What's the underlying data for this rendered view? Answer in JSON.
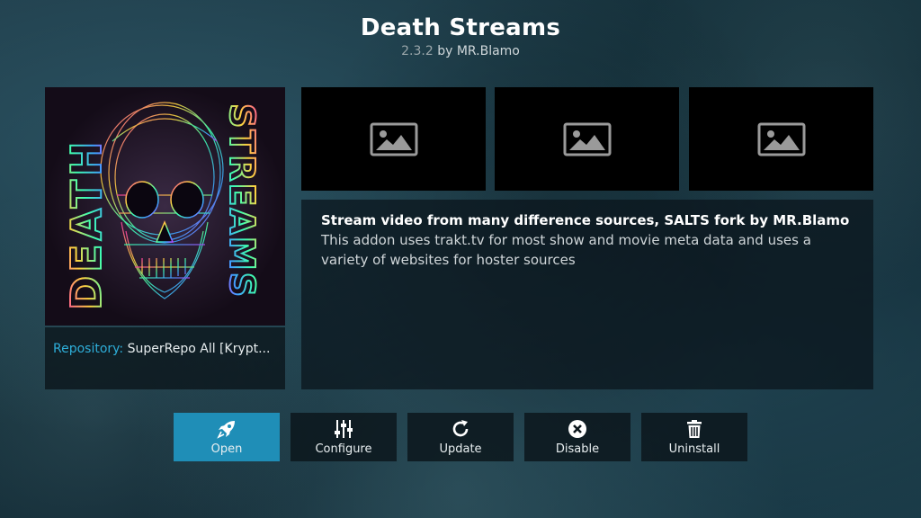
{
  "addon": {
    "title": "Death Streams",
    "version": "2.3.2",
    "author_text": "by MR.Blamo"
  },
  "repository": {
    "label": "Repository:",
    "value": "SuperRepo All [Krypt..."
  },
  "poster": {
    "left_word": "DEATH",
    "right_word": "STREAMS"
  },
  "screenshots": [
    {
      "icon": "image-placeholder-icon"
    },
    {
      "icon": "image-placeholder-icon"
    },
    {
      "icon": "image-placeholder-icon"
    }
  ],
  "description": {
    "heading": "Stream video from many difference sources, SALTS fork by MR.Blamo",
    "line1": "This addon uses trakt.tv for most show and movie meta data and uses a",
    "line2": "variety of websites for hoster sources"
  },
  "actions": [
    {
      "label": "Open",
      "icon": "rocket-icon",
      "active": true
    },
    {
      "label": "Configure",
      "icon": "sliders-icon",
      "active": false
    },
    {
      "label": "Update",
      "icon": "refresh-icon",
      "active": false
    },
    {
      "label": "Disable",
      "icon": "close-circle-icon",
      "active": false
    },
    {
      "label": "Uninstall",
      "icon": "trash-icon",
      "active": false
    }
  ],
  "colors": {
    "accent": "#1f8eb7",
    "repo_label": "#2eaed9"
  }
}
